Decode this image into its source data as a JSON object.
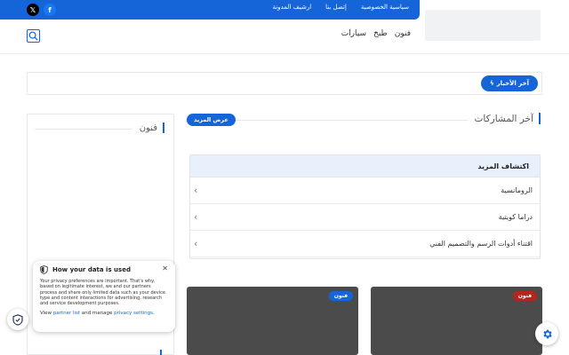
{
  "colors": {
    "accent": "#1565d8",
    "card_bg": "#4b4b4b",
    "tag_blue": "#1565d8",
    "tag_red": "#b3261e",
    "explore_head_bg": "#e8f0fb"
  },
  "topbar": {
    "links": [
      "سياسية الخصوصية",
      "إتصل بنا",
      "ارشيف المدونة"
    ],
    "social": [
      {
        "icon": "x-icon",
        "glyph": "𝕏"
      },
      {
        "icon": "facebook-icon",
        "glyph": "f"
      }
    ]
  },
  "nav": {
    "items": [
      "فنون",
      "طبخ",
      "سيارات"
    ],
    "search_icon": "search-icon"
  },
  "news": {
    "button_label": "آخر الأخبار",
    "icon": "bolt-icon"
  },
  "latest": {
    "title": "آخر المشاركات",
    "more_label": "عرض المزيد"
  },
  "sidebar": {
    "title": "فنون"
  },
  "explore": {
    "title": "اكتشاف المزيد",
    "items": [
      "الرومانسية",
      "دراما كويتية",
      "اقتناء أدوات الرسم والتصميم الفني"
    ]
  },
  "cards": [
    {
      "tag": "فنون",
      "tag_color": "#b3261e"
    },
    {
      "tag": "فنون",
      "tag_color": "#1565d8"
    }
  ],
  "privacy": {
    "title": "How your data is used",
    "body": "Your privacy preferences are important. That's why, based on legitimate interest, we and our partners process and share only limited data such as your device type and content interactions for advertising, research and service development purposes.",
    "footer_prefix": "View ",
    "partner_link": "partner list",
    "footer_middle": " and manage ",
    "settings_link": "privacy settings",
    "footer_suffix": "."
  }
}
